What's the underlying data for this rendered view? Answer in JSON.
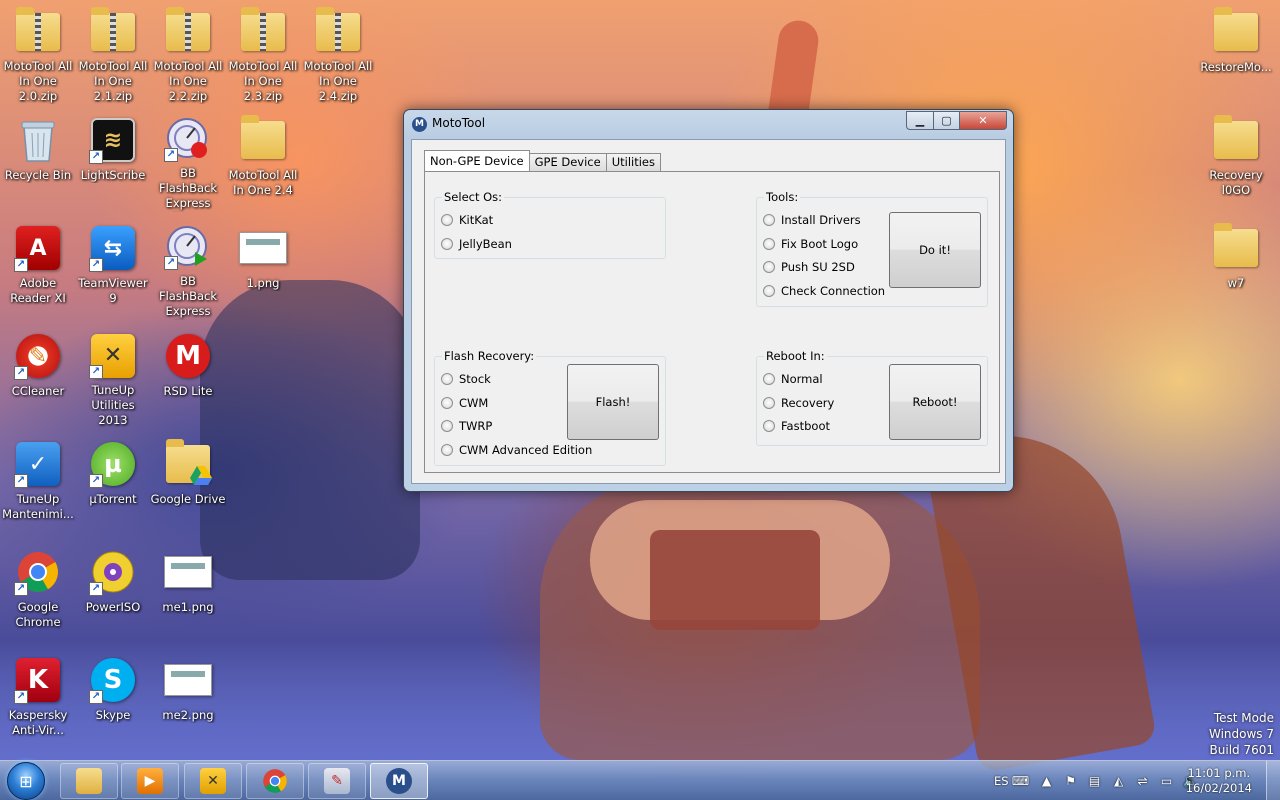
{
  "desktop": {
    "icons": [
      {
        "label": "MotoTool All\nIn One 2.0.zip",
        "kind": "zip"
      },
      {
        "label": "MotoTool All\nIn One 2.1.zip",
        "kind": "zip"
      },
      {
        "label": "MotoTool All\nIn One 2.2.zip",
        "kind": "zip"
      },
      {
        "label": "MotoTool All\nIn One 2.3.zip",
        "kind": "zip"
      },
      {
        "label": "MotoTool All\nIn One 2.4.zip",
        "kind": "zip"
      },
      {
        "label": "Recycle Bin",
        "kind": "recycle"
      },
      {
        "label": "LightScribe",
        "kind": "lightscribe"
      },
      {
        "label": "BB FlashBack\nExpress Rec...",
        "kind": "flashback-rec"
      },
      {
        "label": "MotoTool All\nIn One 2.4",
        "kind": "folder"
      },
      {
        "label": "Adobe\nReader XI",
        "kind": "adobe"
      },
      {
        "label": "TeamViewer\n9",
        "kind": "teamviewer"
      },
      {
        "label": "BB FlashBack\nExpress Pla...",
        "kind": "flashback-play"
      },
      {
        "label": "1.png",
        "kind": "image"
      },
      {
        "label": "CCleaner",
        "kind": "ccleaner"
      },
      {
        "label": "TuneUp\nUtilities 2013",
        "kind": "tuneup"
      },
      {
        "label": "RSD Lite",
        "kind": "rsd"
      },
      {
        "label": "TuneUp\nMantenimi...",
        "kind": "tuneup-maint"
      },
      {
        "label": "µTorrent",
        "kind": "utorrent"
      },
      {
        "label": "Google Drive",
        "kind": "gdrive"
      },
      {
        "label": "Google\nChrome",
        "kind": "chrome"
      },
      {
        "label": "PowerISO",
        "kind": "poweriso"
      },
      {
        "label": "me1.png",
        "kind": "image"
      },
      {
        "label": "Kaspersky\nAnti-Vir...",
        "kind": "kaspersky"
      },
      {
        "label": "Skype",
        "kind": "skype"
      },
      {
        "label": "me2.png",
        "kind": "image"
      },
      {
        "label": "RestoreMo...",
        "kind": "folder"
      },
      {
        "label": "Recovery\nl0GO",
        "kind": "folder"
      },
      {
        "label": "w7",
        "kind": "folder"
      }
    ]
  },
  "window": {
    "title": "MotoTool",
    "app_icon_glyph": "M",
    "tabs": [
      "Non-GPE Device",
      "GPE Device",
      "Utilities"
    ],
    "select_os": {
      "label": "Select Os:",
      "options": [
        "KitKat",
        "JellyBean"
      ]
    },
    "tools": {
      "label": "Tools:",
      "options": [
        "Install Drivers",
        "Fix Boot Logo",
        "Push SU 2SD",
        "Check Connection"
      ],
      "button": "Do it!"
    },
    "flash_recovery": {
      "label": "Flash Recovery:",
      "options": [
        "Stock",
        "CWM",
        "TWRP",
        "CWM Advanced Edition"
      ],
      "button": "Flash!"
    },
    "reboot_in": {
      "label": "Reboot In:",
      "options": [
        "Normal",
        "Recovery",
        "Fastboot"
      ],
      "button": "Reboot!"
    }
  },
  "watermark": {
    "line1": "Test Mode",
    "line2": "Windows 7",
    "line3": "Build 7601"
  },
  "taskbar": {
    "language": "ES",
    "time": "11:01 p.m.",
    "date": "16/02/2014"
  },
  "colors": {
    "accent": "#2b7fd6",
    "close_button": "#c8473a"
  }
}
